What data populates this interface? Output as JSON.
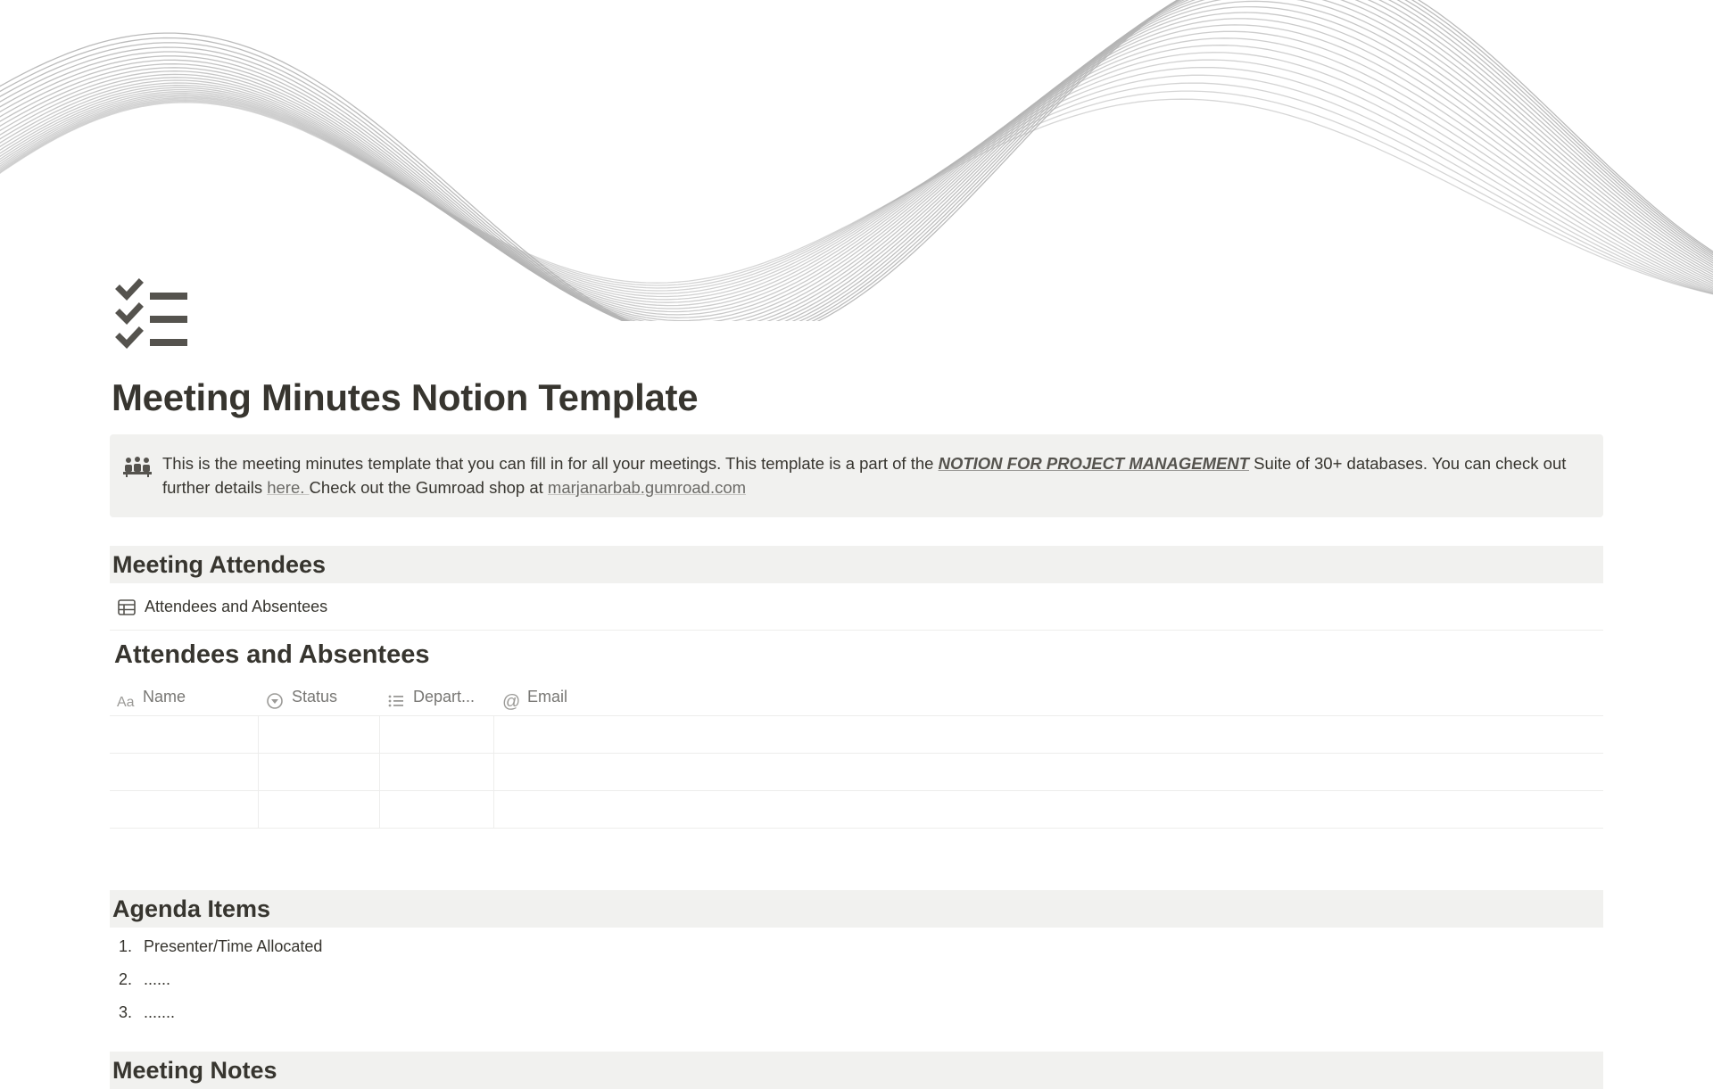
{
  "page": {
    "title": "Meeting Minutes Notion Template",
    "icon": "checklist-icon"
  },
  "callout": {
    "icon": "meeting-people-icon",
    "text_before": "This is the meeting minutes template that you can fill in for all your meetings. This template is a part of the ",
    "bold_link": "NOTION FOR PROJECT MANAGEMENT",
    "text_middle": " Suite of 30+ databases. You can check out further details ",
    "here_link": "here. ",
    "text_after": " Check out the  Gumroad shop at ",
    "shop_link": "marjanarbab.gumroad.com"
  },
  "sections": {
    "attendees_heading": "Meeting Attendees",
    "agenda_heading": "Agenda Items",
    "notes_heading": "Meeting Notes"
  },
  "database_link": {
    "icon": "table-icon",
    "label": "Attendees and Absentees"
  },
  "database": {
    "title": "Attendees and Absentees",
    "columns": [
      {
        "icon": "text-property-icon",
        "label": "Name"
      },
      {
        "icon": "status-property-icon",
        "label": "Status"
      },
      {
        "icon": "list-property-icon",
        "label": "Depart..."
      },
      {
        "icon": "at-sign-icon",
        "label": "Email"
      }
    ],
    "rows": [
      [
        "",
        "",
        "",
        ""
      ],
      [
        "",
        "",
        "",
        ""
      ],
      [
        "",
        "",
        "",
        ""
      ]
    ]
  },
  "agenda": {
    "items": [
      {
        "number": "1.",
        "text": " Presenter/Time Allocated"
      },
      {
        "number": "2.",
        "text": "......"
      },
      {
        "number": "3.",
        "text": "......."
      }
    ]
  }
}
